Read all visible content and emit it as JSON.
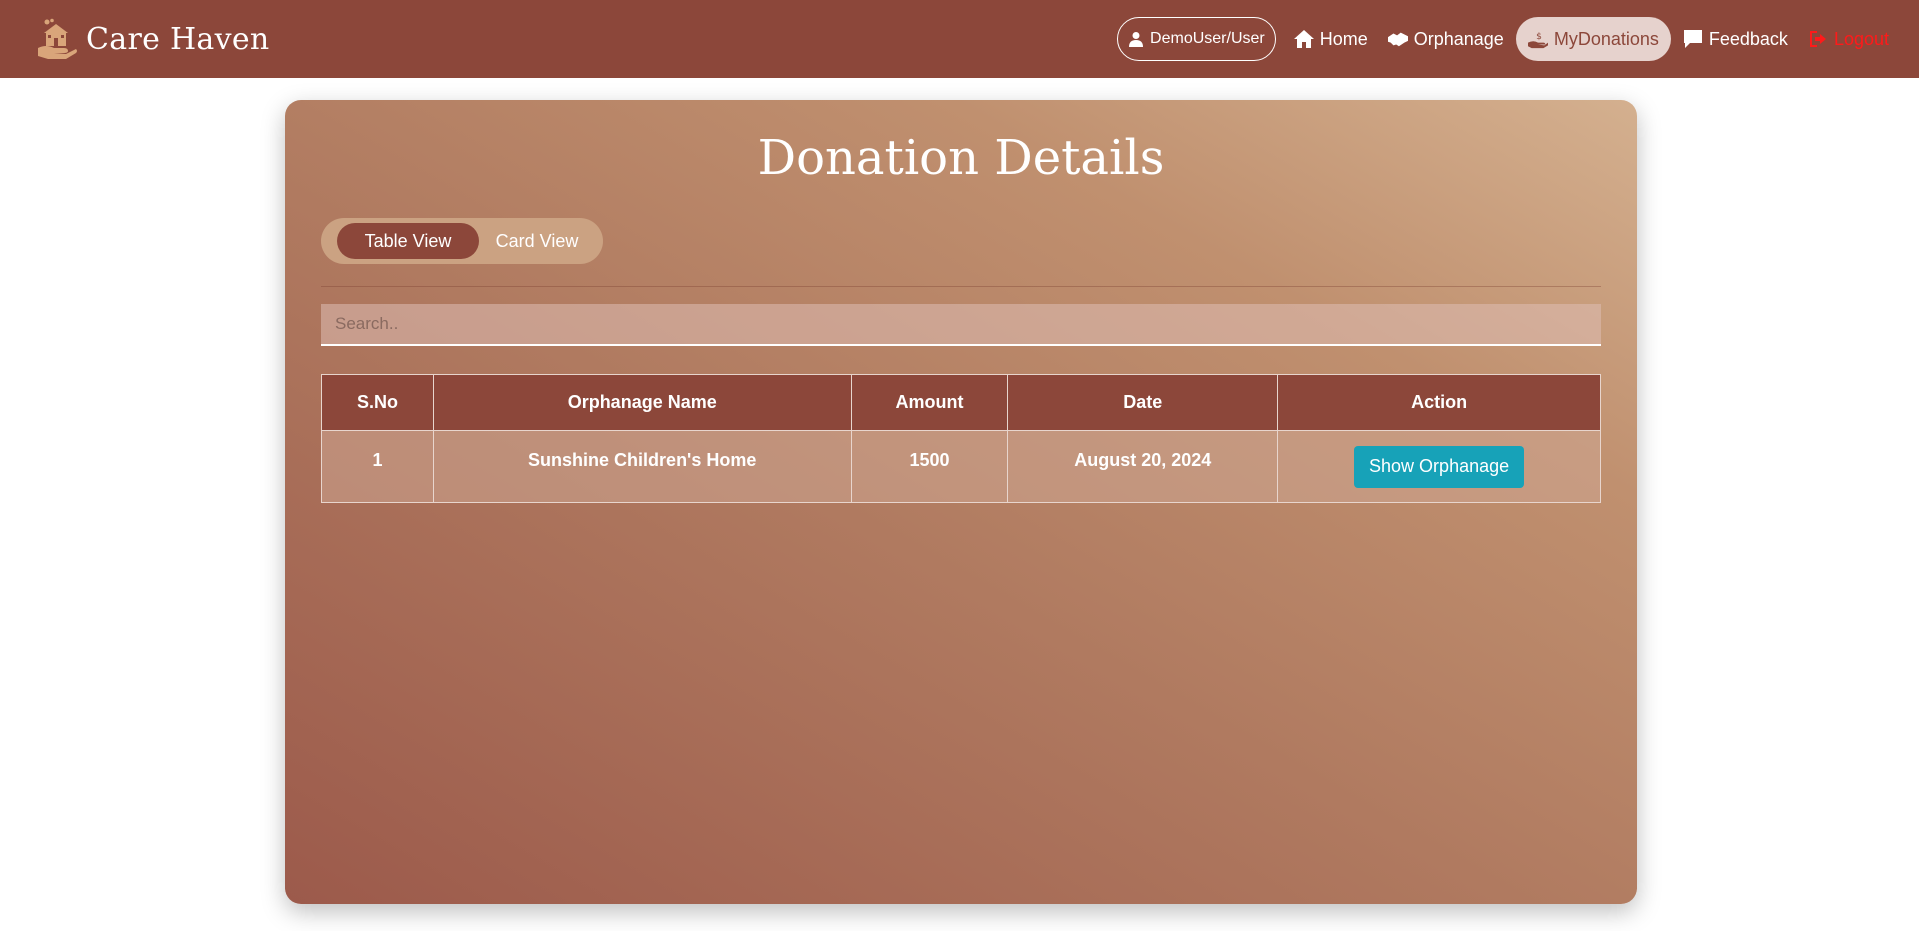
{
  "brand": {
    "name": "Care Haven",
    "logo_icon": "hand-house-icon",
    "logo_color": "#d9a57a"
  },
  "nav": {
    "user": "DemoUser/User",
    "items": [
      {
        "label": "Home",
        "icon": "home-icon"
      },
      {
        "label": "Orphanage",
        "icon": "handshake-icon"
      },
      {
        "label": "MyDonations",
        "icon": "donation-hand-icon",
        "active": true
      },
      {
        "label": "Feedback",
        "icon": "comment-icon"
      },
      {
        "label": "Logout",
        "icon": "logout-icon"
      }
    ]
  },
  "page": {
    "title": "Donation Details"
  },
  "view_toggle": {
    "table": "Table View",
    "card": "Card View"
  },
  "search": {
    "placeholder": "Search.."
  },
  "table": {
    "headers": [
      "S.No",
      "Orphanage Name",
      "Amount",
      "Date",
      "Action"
    ],
    "rows": [
      {
        "sno": "1",
        "name": "Sunshine Children's Home",
        "amount": "1500",
        "date": "August 20, 2024",
        "action": "Show Orphanage"
      }
    ]
  },
  "colors": {
    "primary": "#8c473a",
    "accent_button": "#17a2b8",
    "logout": "#ff1a1a",
    "active_nav_bg": "#e6d2cd"
  }
}
